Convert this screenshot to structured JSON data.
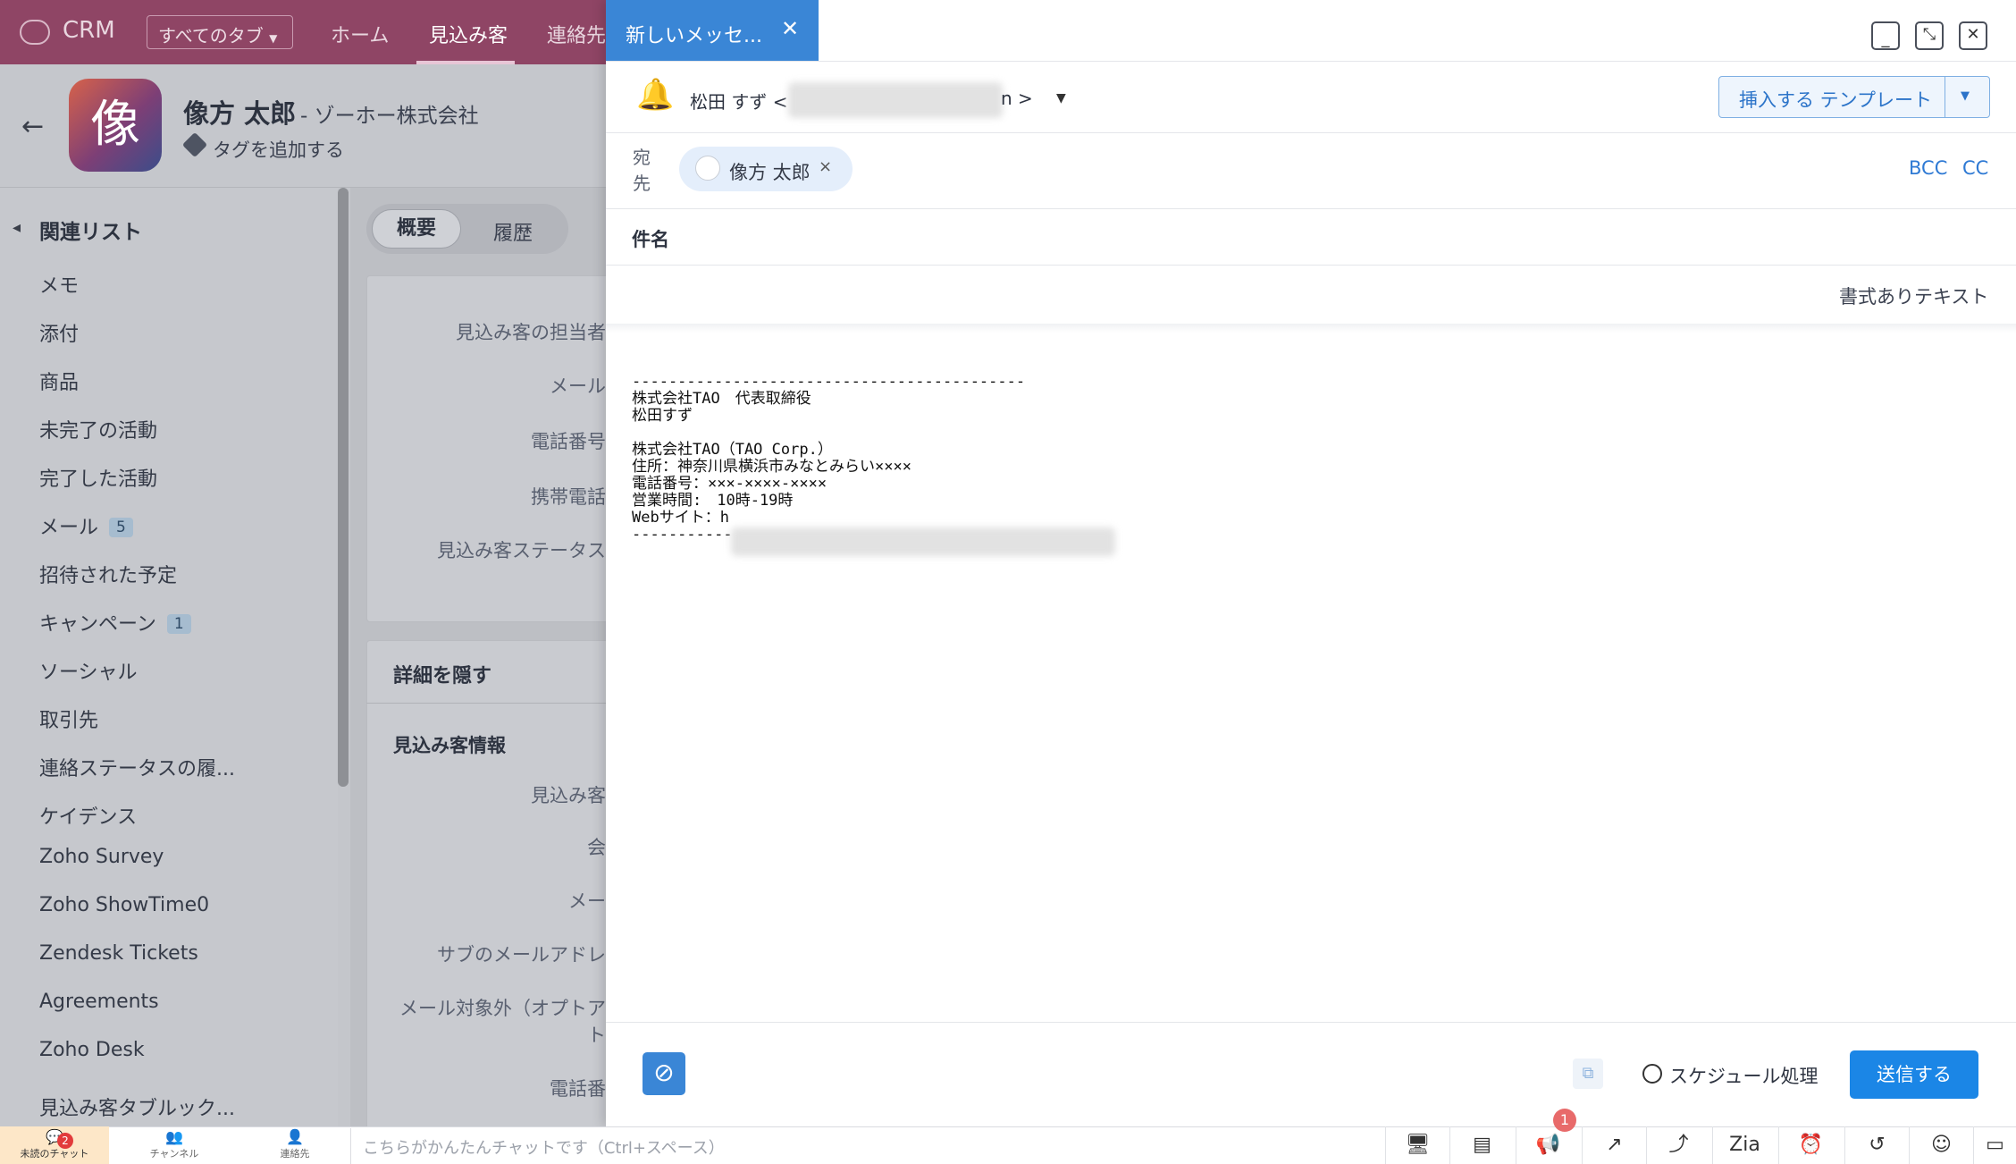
{
  "topnav": {
    "logo": "CRM",
    "tabs_btn": "すべてのタブ",
    "tabs": [
      "ホーム",
      "見込み客",
      "連絡先"
    ]
  },
  "record": {
    "avatar_char": "像",
    "name": "像方 太郎",
    "company": "- ゾーホー株式会社",
    "add_tag": "タグを追加する"
  },
  "related": {
    "title": "関連リスト",
    "items": [
      {
        "label": "メモ"
      },
      {
        "label": "添付"
      },
      {
        "label": "商品"
      },
      {
        "label": "未完了の活動"
      },
      {
        "label": "完了した活動"
      },
      {
        "label": "メール",
        "count": "5"
      },
      {
        "label": "招待された予定"
      },
      {
        "label": "キャンペーン",
        "count": "1"
      },
      {
        "label": "ソーシャル"
      },
      {
        "label": "取引先"
      },
      {
        "label": "連絡ステータスの履..."
      },
      {
        "label": "ケイデンス"
      },
      {
        "label": "Zoho Survey"
      },
      {
        "label": "Zoho ShowTime0"
      },
      {
        "label": "Zendesk Tickets"
      },
      {
        "label": "Agreements"
      },
      {
        "label": "Zoho Desk"
      },
      {
        "label": "見込み客タブルック..."
      }
    ]
  },
  "detail": {
    "tab_overview": "概要",
    "tab_history": "履歴",
    "summary_fields": [
      "見込み客の担当者",
      "メール",
      "電話番号",
      "携帯電話",
      "見込み客ステータス"
    ],
    "hide_details": "詳細を隠す",
    "section": "見込み客情報",
    "info_fields": [
      "見込み客",
      "会",
      "メー",
      "サブのメールアドレ",
      "メール対象外（オプトア",
      "ト",
      "電話番"
    ]
  },
  "composer": {
    "tab_title": "新しいメッセ...",
    "from_name": "松田 すず <",
    "from_suffix": "n >",
    "template_btn": "挿入する テンプレート",
    "to_label": "宛先",
    "to_label_l1": "宛",
    "to_label_l2": "先",
    "recipient": "像方 太郎",
    "bcc": "BCC",
    "cc": "CC",
    "subject_label": "件名",
    "format_label": "書式ありテキスト",
    "signature": [
      "-------------------------------------------",
      "株式会社TAO　代表取締役",
      "松田すず",
      "",
      "株式会社TAO（TAO Corp.）",
      "住所：神奈川県横浜市みなとみらい××××",
      "電話番号：×××-××××-××××",
      "営業時間:　10時-19時",
      "Webサイト：h",
      "-----------"
    ],
    "schedule": "スケジュール処理",
    "send": "送信する"
  },
  "bottombar": {
    "unread_chats": "未読のチャット",
    "unread_count": "2",
    "channels": "チャンネル",
    "contacts": "連絡先",
    "chat_placeholder": "こちらがかんたんチャットです（Ctrl+スペース）",
    "notif_count": "1"
  },
  "colors": {
    "nav": "#8f4565",
    "accent": "#3a86d6",
    "send": "#1b86e6"
  }
}
